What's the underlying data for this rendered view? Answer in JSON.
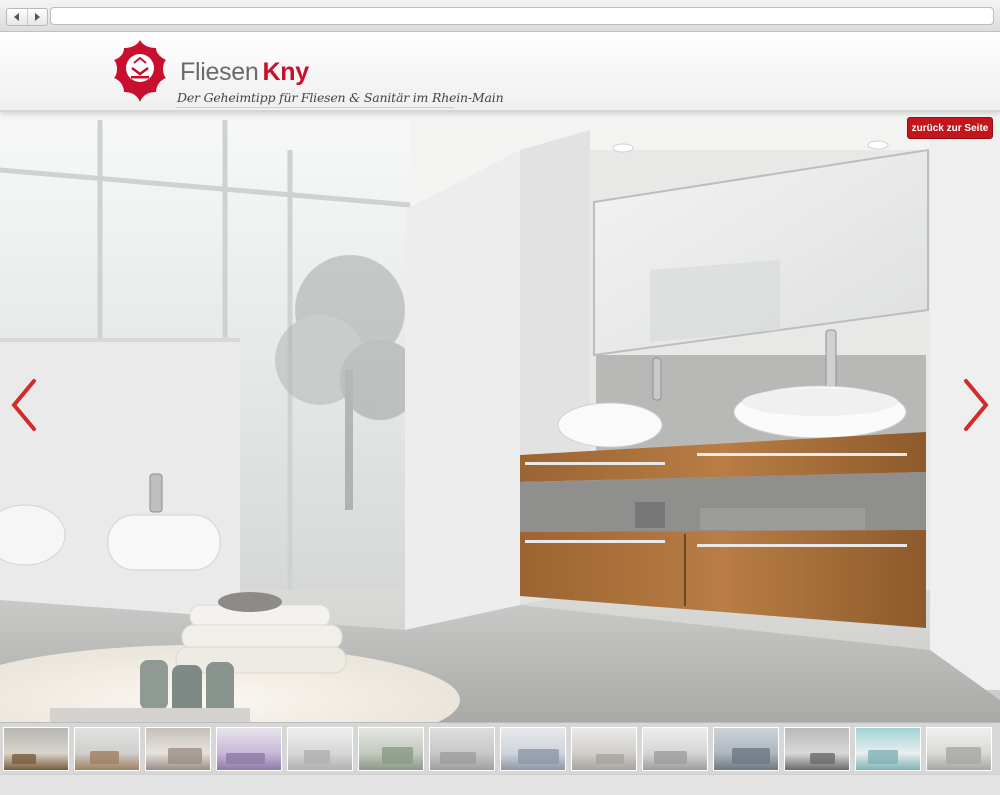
{
  "browser": {
    "back_icon": "back-icon",
    "forward_icon": "forward-icon"
  },
  "header": {
    "brand_part1": "Fliesen",
    "brand_part2": "Kny",
    "tagline": "Der Geheimtipp für Fliesen & Sanitär im Rhein-Main",
    "brand_color": "#c8102e",
    "logo_icon": "fliesen-kny-logo"
  },
  "gallery": {
    "back_button_label": "zurück zur Seite",
    "prev_icon": "chevron-left-icon",
    "next_icon": "chevron-right-icon",
    "accent_color": "#c4151c",
    "thumbnail_count": 14
  }
}
